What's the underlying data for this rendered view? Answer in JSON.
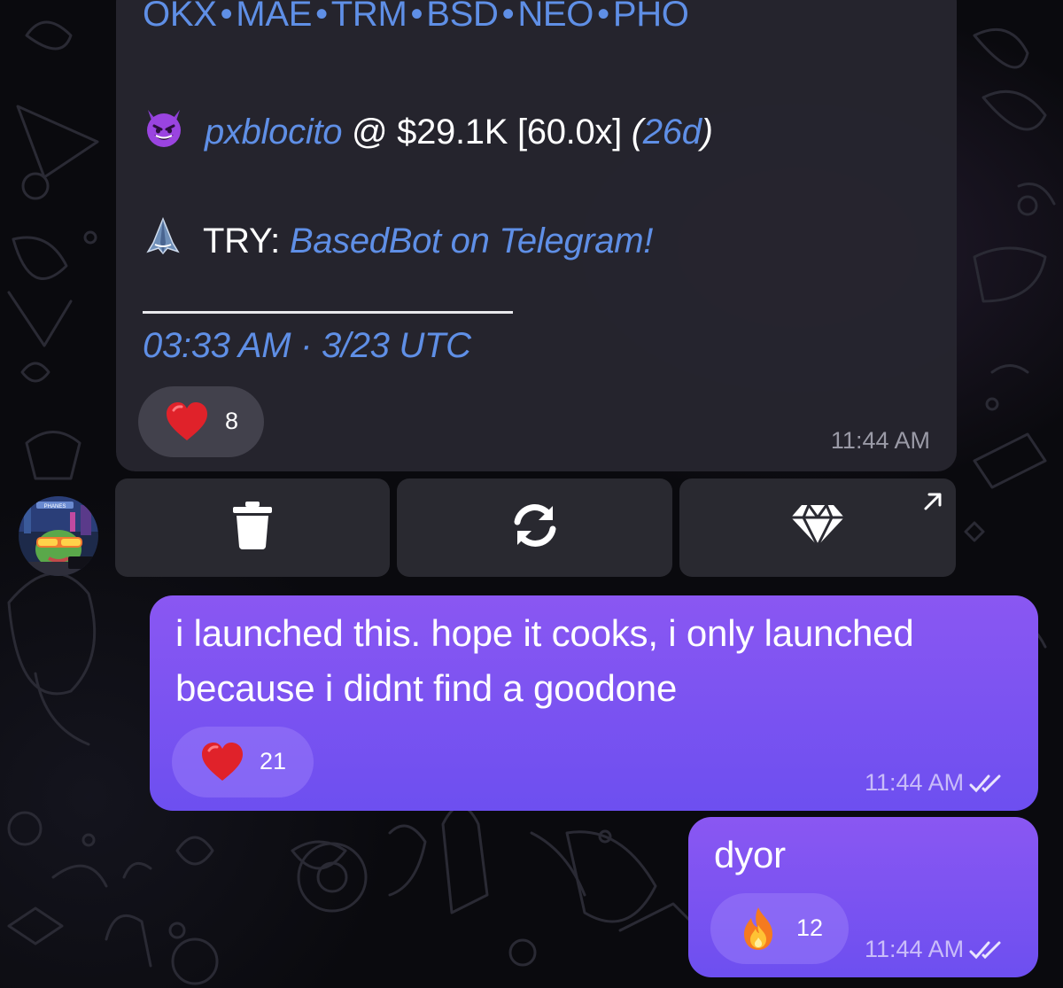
{
  "background": {
    "pattern": "doodle-wallpaper-icons"
  },
  "colors": {
    "link": "#5f8fe6",
    "card_bg": "#26252e",
    "outgoing_gradient_top": "#8a57f2",
    "outgoing_gradient_bottom": "#6d4ff0",
    "heart": "#e0222a"
  },
  "incoming_message": {
    "tickers": [
      "OKX",
      "MAE",
      "TRM",
      "BSD",
      "NEO",
      "PHO"
    ],
    "ticker_separator": "•",
    "dev_emoji": "smiling-imp-emoji",
    "dev_name": "pxblocito",
    "dev_at": "@",
    "dev_mcap": "$29.1K",
    "dev_multiple": "[60.0x]",
    "dev_age_open": "(",
    "dev_age": "26d",
    "dev_age_close": ")",
    "try_icon": "shark-icon",
    "try_label": "TRY:",
    "try_link": "BasedBot on Telegram!",
    "time_utc": "03:33 AM · 3/23 UTC",
    "reaction": {
      "emoji": "red-heart",
      "count": "8"
    },
    "time": "11:44 AM"
  },
  "inline_keyboard": [
    {
      "icon": "trash-icon"
    },
    {
      "icon": "refresh-icon"
    },
    {
      "icon": "diamond-icon",
      "corner_icon": "arrow-up-right-icon"
    }
  ],
  "avatar": {
    "badge_text": "PHANES"
  },
  "outgoing_messages": [
    {
      "line1": "i launched this. hope it cooks, i only launched",
      "line2": "because i didnt find a goodone",
      "reaction": {
        "emoji": "red-heart",
        "count": "21"
      },
      "time": "11:44 AM",
      "status": "read-double-check"
    },
    {
      "text": "dyor",
      "reaction": {
        "emoji": "fire",
        "count": "12"
      },
      "time": "11:44 AM",
      "status": "read-double-check"
    }
  ]
}
